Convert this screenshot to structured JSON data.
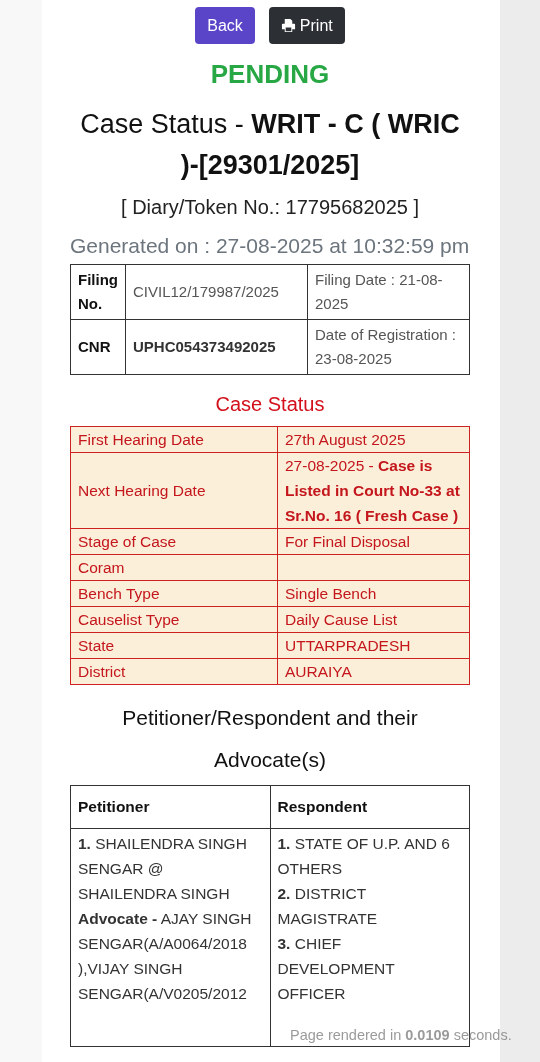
{
  "buttons": [
    {
      "kind": "back",
      "label": "Back"
    },
    {
      "kind": "print",
      "label": "Print"
    }
  ],
  "status_badge": "PENDING",
  "title": "Case Status - **WRIT - C ( WRIC )-[29301/2025]**",
  "diary": "[ Diary/Token No.: 17795682025 ]",
  "generated": "Generated on : 27-08-2025 at 10:32:59 pm",
  "filing_table": [
    {
      "label": "Filing No.",
      "value": "CIVIL12/179987/2025",
      "value_bold": false,
      "extra": "Filing Date : 21-08-2025"
    },
    {
      "label": "CNR",
      "value": "UPHC054373492025",
      "value_bold": true,
      "extra": "Date of Registration : 23-08-2025"
    }
  ],
  "case_status": {
    "heading": "Case Status",
    "rows": [
      {
        "label": "First Hearing Date",
        "value": "27th August 2025"
      },
      {
        "label": "Next Hearing Date",
        "value": "27-08-2025 - **Case is Listed in Court No-33 at Sr.No. 16 ( Fresh Case )**"
      },
      {
        "label": "Stage of Case",
        "value": "For Final Disposal"
      },
      {
        "label": "Coram"
      },
      {
        "label": "Bench Type",
        "value": "Single Bench"
      },
      {
        "label": "Causelist Type",
        "value": "Daily Cause List"
      },
      {
        "label": "State",
        "value": "UTTARPRADESH"
      },
      {
        "label": "District",
        "value": "AURAIYA"
      }
    ]
  },
  "parties": {
    "heading": "Petitioner/Respondent and their Advocate(s)",
    "columns": [
      "Petitioner",
      "Respondent"
    ],
    "petitioner": "**1.** SHAILENDRA SINGH SENGAR @ SHAILENDRA SINGH **Advocate -** AJAY SINGH SENGAR(A/A0064/2018 ),VIJAY SINGH SENGAR(A/V0205/2012",
    "respondents": [
      "**1.** STATE OF U.P. AND 6 OTHERS",
      "**2.** DISTRICT MAGISTRATE",
      "**3.** CHIEF DEVELOPMENT OFFICER"
    ]
  },
  "footer_note": "Page rendered in **0.0109** seconds."
}
